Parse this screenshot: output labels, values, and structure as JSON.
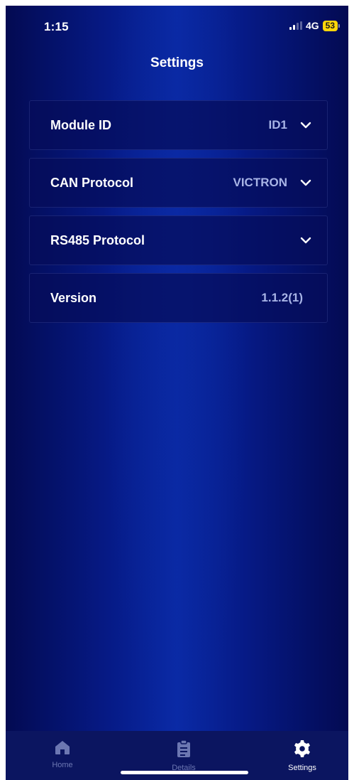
{
  "status_bar": {
    "time": "1:15",
    "network": "4G",
    "battery": "53"
  },
  "page": {
    "title": "Settings"
  },
  "settings": [
    {
      "label": "Module ID",
      "value": "ID1",
      "has_dropdown": true
    },
    {
      "label": "CAN Protocol",
      "value": "VICTRON",
      "has_dropdown": true
    },
    {
      "label": "RS485 Protocol",
      "value": "",
      "has_dropdown": true
    },
    {
      "label": "Version",
      "value": "1.1.2(1)",
      "has_dropdown": false
    }
  ],
  "tab_bar": {
    "tabs": [
      {
        "label": "Home",
        "icon": "home-icon",
        "active": false
      },
      {
        "label": "Details",
        "icon": "clipboard-icon",
        "active": false
      },
      {
        "label": "Settings",
        "icon": "gear-icon",
        "active": true
      }
    ]
  },
  "colors": {
    "background_dark": "#030a52",
    "background_center": "#0a2aa6",
    "row_background": "#050c5a",
    "value_text": "#a8b4e6",
    "tab_inactive": "#6c77b2",
    "battery": "#ffd60a"
  }
}
